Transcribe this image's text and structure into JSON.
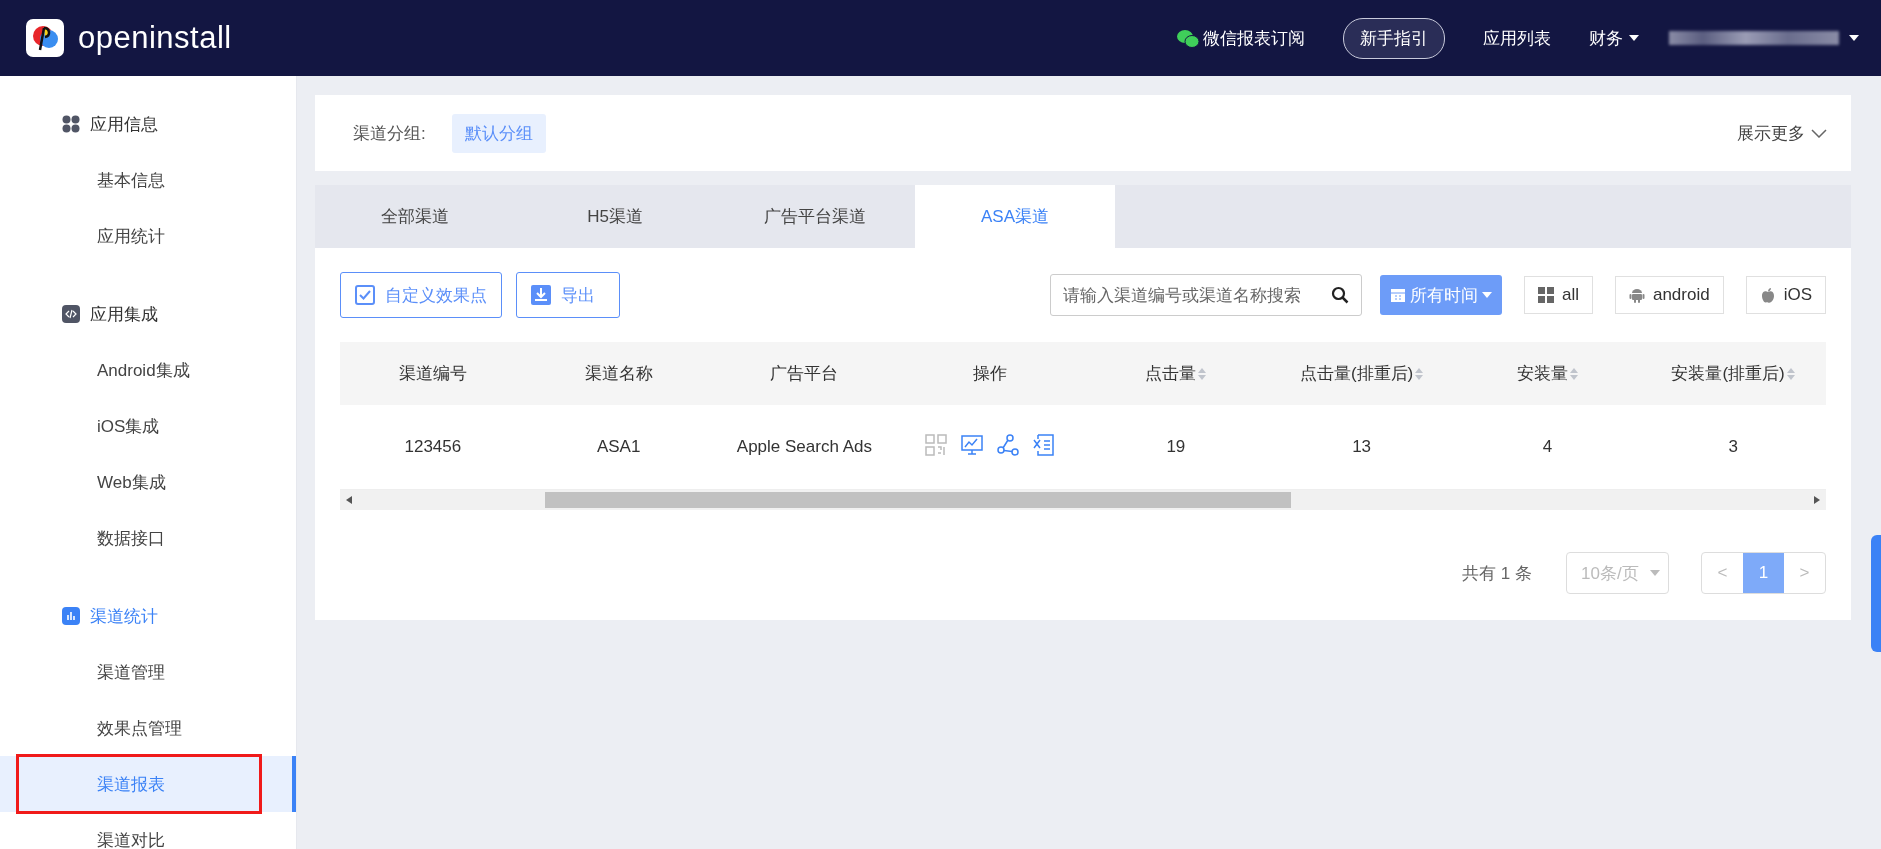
{
  "header": {
    "brand": "openinstall",
    "links": [
      {
        "kind": "wechat",
        "label": "微信报表订阅"
      },
      {
        "kind": "outlined",
        "label": "新手指引"
      },
      {
        "kind": "plain",
        "label": "应用列表"
      },
      {
        "kind": "dropdown",
        "label": "财务"
      }
    ]
  },
  "sidebar": {
    "groups": [
      {
        "kind": "apps",
        "label": "应用信息",
        "selected": false,
        "items": [
          {
            "label": "基本信息",
            "selected": false,
            "highlighted": false
          },
          {
            "label": "应用统计",
            "selected": false,
            "highlighted": false
          }
        ]
      },
      {
        "kind": "code",
        "label": "应用集成",
        "selected": false,
        "items": [
          {
            "label": "Android集成",
            "selected": false,
            "highlighted": false
          },
          {
            "label": "iOS集成",
            "selected": false,
            "highlighted": false
          },
          {
            "label": "Web集成",
            "selected": false,
            "highlighted": false
          },
          {
            "label": "数据接口",
            "selected": false,
            "highlighted": false
          }
        ]
      },
      {
        "kind": "chart",
        "label": "渠道统计",
        "selected": true,
        "items": [
          {
            "label": "渠道管理",
            "selected": false,
            "highlighted": false
          },
          {
            "label": "效果点管理",
            "selected": false,
            "highlighted": false
          },
          {
            "label": "渠道报表",
            "selected": true,
            "highlighted": true
          },
          {
            "label": "渠道对比",
            "selected": false,
            "highlighted": false
          }
        ]
      }
    ]
  },
  "filter": {
    "label": "渠道分组:",
    "chip": "默认分组",
    "more": "展示更多"
  },
  "tabs": [
    {
      "label": "全部渠道",
      "selected": false
    },
    {
      "label": "H5渠道",
      "selected": false
    },
    {
      "label": "广告平台渠道",
      "selected": false
    },
    {
      "label": "ASA渠道",
      "selected": true
    }
  ],
  "toolbar": {
    "buttons": [
      {
        "kind": "checkbox",
        "label": "自定义效果点"
      },
      {
        "kind": "download",
        "label": "导出"
      }
    ],
    "search": {
      "placeholder": "请输入渠道编号或渠道名称搜索"
    },
    "time_button": "所有时间",
    "platforms": [
      {
        "kind": "all",
        "label": "all"
      },
      {
        "kind": "android",
        "label": "android"
      },
      {
        "kind": "apple",
        "label": "iOS"
      }
    ]
  },
  "table": {
    "columns": [
      {
        "label": "渠道编号",
        "kind": "text",
        "sortable": false
      },
      {
        "label": "渠道名称",
        "kind": "text",
        "sortable": false
      },
      {
        "label": "广告平台",
        "kind": "text",
        "sortable": false
      },
      {
        "label": "操作",
        "kind": "actions",
        "sortable": false
      },
      {
        "label": "点击量",
        "kind": "text",
        "sortable": true
      },
      {
        "label": "点击量(排重后)",
        "kind": "text",
        "sortable": true
      },
      {
        "label": "安装量",
        "kind": "text",
        "sortable": true
      },
      {
        "label": "安装量(排重后)",
        "kind": "text",
        "sortable": true
      }
    ],
    "rows": [
      {
        "cells": [
          "123456",
          "ASA1",
          "Apple Search Ads",
          "",
          "19",
          "13",
          "4",
          "3"
        ]
      }
    ]
  },
  "pagination": {
    "total": "共有 1 条",
    "page_size": "10条/页",
    "prev": "<",
    "pages": [
      {
        "label": "1",
        "selected": true
      }
    ],
    "next": ">"
  }
}
